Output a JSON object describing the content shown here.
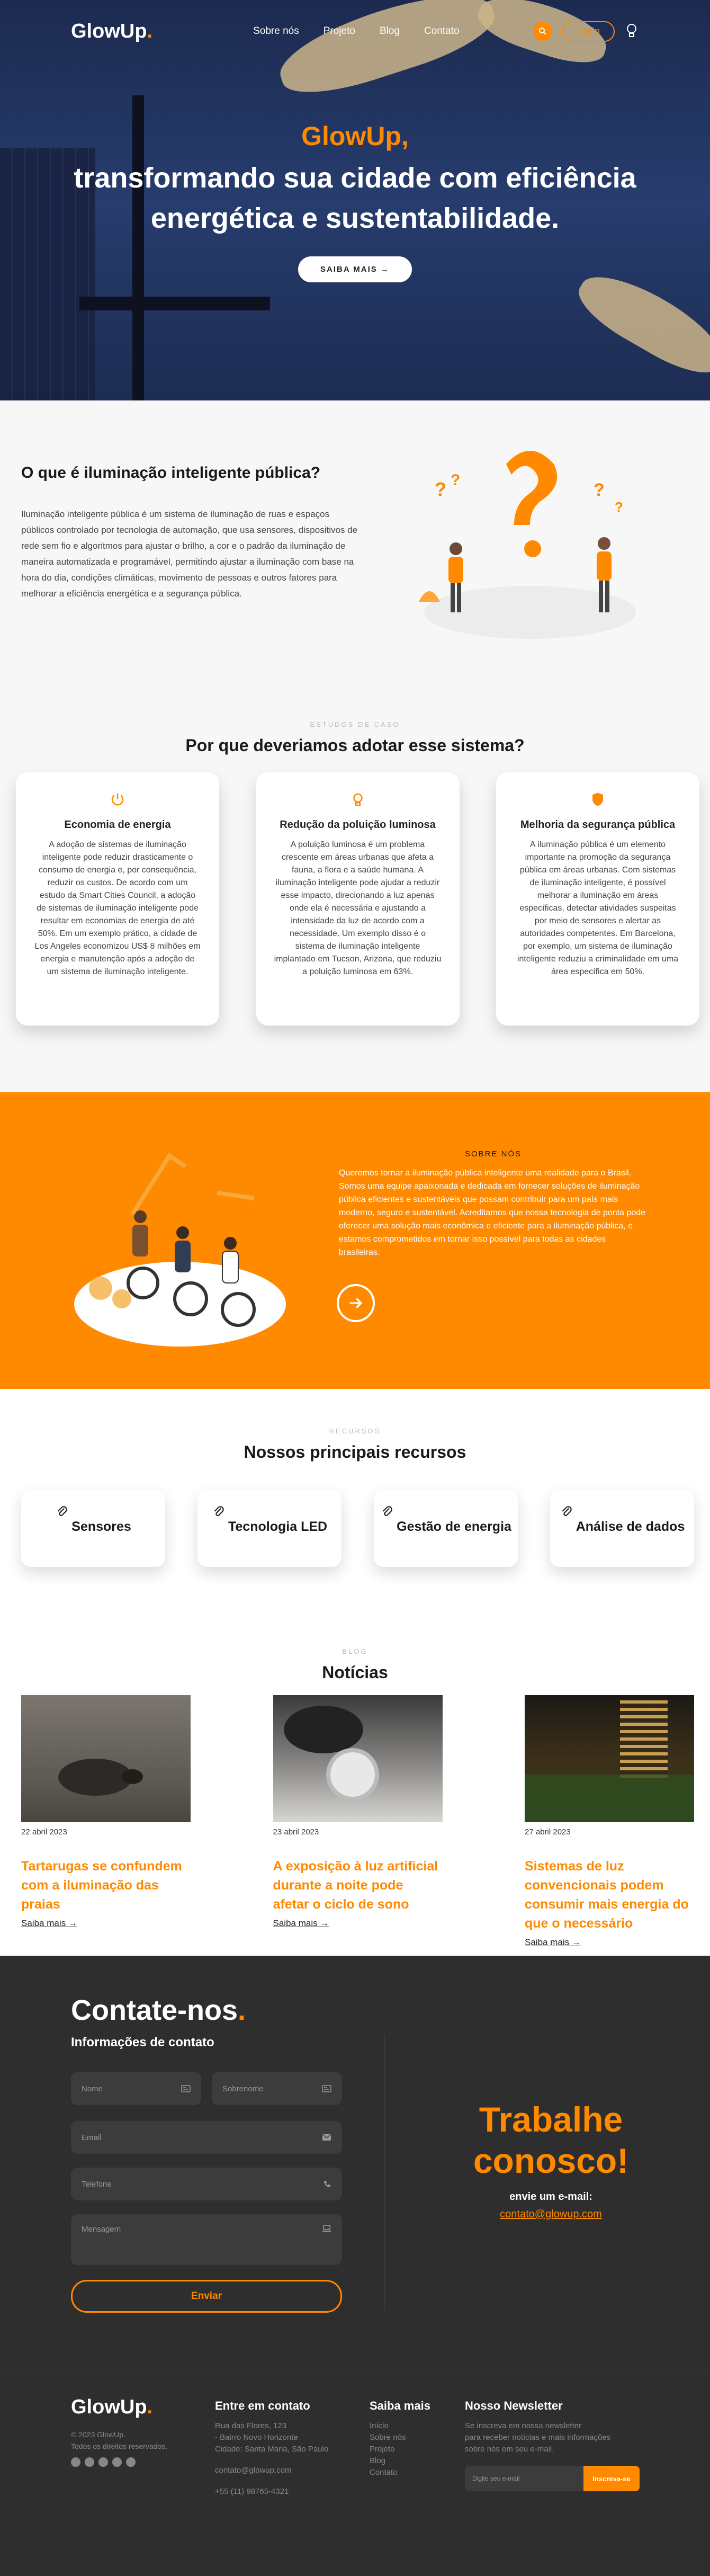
{
  "brand": {
    "name": "GlowUp",
    "dot": ".",
    "accent": "#ff8a00"
  },
  "nav": {
    "links": [
      "Sobre nós",
      "Projeto",
      "Blog",
      "Contato"
    ],
    "login": "Login",
    "icons": [
      "search-icon",
      "lightbulb-icon"
    ]
  },
  "hero": {
    "title_line1": "GlowUp,",
    "title_line2": "transformando sua cidade com eficiência",
    "title_line3": "energética e sustentabilidade.",
    "cta": "SAIBA MAIS →"
  },
  "what": {
    "title": "O que é iluminação inteligente pública?",
    "body": "Iluminação inteligente pública é um sistema de iluminação de ruas e espaços públicos controlado por tecnologia de automação, que usa sensores, dispositivos de rede sem fio e algoritmos para ajustar o brilho, a cor e o padrão da iluminação de maneira automatizada e programável, permitindo ajustar a iluminação com base na hora do dia, condições climáticas, movimento de pessoas e outros fatores para melhorar a eficiência energética e a segurança pública."
  },
  "why": {
    "eyebrow": "ESTUDOS DE CASO",
    "title": "Por que deveriamos adotar esse sistema?",
    "cards": [
      {
        "icon": "power-icon",
        "title": "Economia de energia",
        "body": "A adoção de sistemas de iluminação inteligente pode reduzir drasticamente o consumo de energia e, por consequência, reduzir os custos. De acordo com um estudo da Smart Cities Council, a adoção de sistemas de iluminação inteligente pode resultar em economias de energia de até 50%. Em um exemplo prático, a cidade de Los Angeles economizou US$ 8 milhões em energia e manutenção após a adoção de um sistema de iluminação inteligente."
      },
      {
        "icon": "lightbulb-icon",
        "title": "Redução da poluição luminosa",
        "body": "A poluição luminosa é um problema crescente em áreas urbanas que afeta a fauna, a flora e a saúde humana. A iluminação inteligente pode ajudar a reduzir esse impacto, direcionando a luz apenas onde ela é necessária e ajustando a intensidade da luz de acordo com a necessidade. Um exemplo disso é o sistema de iluminação inteligente implantado em Tucson, Arizona, que reduziu a poluição luminosa em 63%."
      },
      {
        "icon": "shield-icon",
        "title": "Melhoria da segurança pública",
        "body": "A iluminação pública é um elemento importante na promoção da segurança pública em áreas urbanas. Com sistemas de iluminação inteligente, é possível melhorar a iluminação em áreas específicas, detectar atividades suspeitas por meio de sensores e alertar as autoridades competentes. Em Barcelona, por exemplo, um sistema de iluminação inteligente reduziu a criminalidade em uma área específica em 50%."
      }
    ]
  },
  "about": {
    "label": "SOBRE NÓS",
    "body": "Queremos tornar a iluminação pública inteligente uma realidade para o Brasil. Somos uma equipe apaixonada e dedicada em fornecer soluções de iluminação pública eficientes e sustentáveis que possam contribuir para um país mais moderno, seguro e sustentável. Acreditamos que nossa tecnologia de ponta pode oferecer uma solução mais econômica e eficiente para a iluminação pública, e estamos comprometidos em tornar isso possível para todas as cidades brasileiras."
  },
  "resources": {
    "eyebrow": "RECURSOS",
    "title": "Nossos principais recursos",
    "items": [
      "Sensores",
      "Tecnologia LED",
      "Gestão de energia",
      "Análise de dados"
    ]
  },
  "blog": {
    "eyebrow": "BLOG",
    "title": "Notícias",
    "posts": [
      {
        "date": "22 abril 2023",
        "title": "Tartarugas se confundem com a iluminação das praias",
        "more": "Saiba mais →"
      },
      {
        "date": "23 abril 2023",
        "title": "A exposição à luz artificial durante a noite pode afetar o ciclo de sono",
        "more": "Saiba mais →"
      },
      {
        "date": "27 abril 2023",
        "title": "Sistemas de luz convencionais podem consumir mais energia do que o necessário",
        "more": "Saiba mais →"
      }
    ]
  },
  "contact": {
    "title": "Contate-nos",
    "dot": ".",
    "subtitle": "Informações de contato",
    "fields": {
      "name": "Nome",
      "surname": "Sobrenome",
      "email": "Email",
      "phone": "Telefone",
      "message": "Mensagem"
    },
    "send": "Enviar",
    "work_line1": "Trabalhe",
    "work_line2": "conosco!",
    "send_email_label": "envie um e-mail:",
    "email_address": "contato@glowup.com"
  },
  "footer": {
    "logo": "GlowUp",
    "dot": ".",
    "copyright_line1": "© 2023 GlowUp.",
    "copyright_line2": "Todos os direitos reservados.",
    "col1": {
      "title": "Entre em contato",
      "address_line1": "Rua das Flores, 123",
      "address_line2": "- Bairro Novo Horizonte",
      "address_line3": "Cidade: Santa Maria, São Paulo",
      "email": "contato@glowup.com",
      "phone": "+55 (11) 98765-4321"
    },
    "col2": {
      "title": "Saiba mais",
      "links": [
        "Início",
        "Sobre nós",
        "Projeto",
        "Blog",
        "Contato"
      ]
    },
    "col3": {
      "title": "Nosso Newsletter",
      "line1": "Se inscreva em nossa newsletter",
      "line2": "para receber notícias e mais informações",
      "line3": "sobre nós em seu e-mail.",
      "placeholder": "Digite seu e-mail",
      "button": "Inscreva-se"
    }
  }
}
